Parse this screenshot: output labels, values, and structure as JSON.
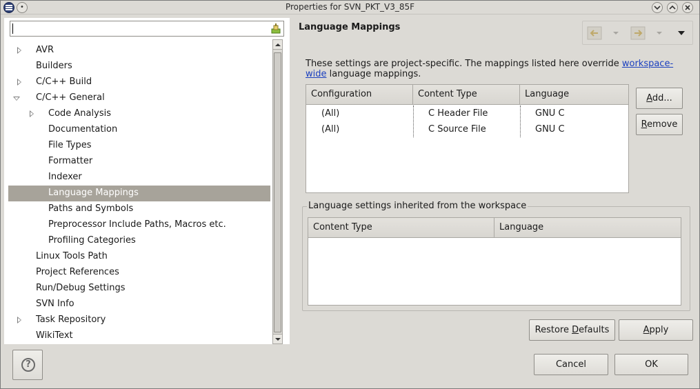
{
  "window": {
    "title": "Properties for SVN_PKT_V3_85F"
  },
  "filter": {
    "value": "",
    "placeholder": ""
  },
  "tree": {
    "items": [
      {
        "label": "AVR",
        "level": 1,
        "twisty": "collapsed",
        "selected": false
      },
      {
        "label": "Builders",
        "level": 1,
        "twisty": "none",
        "selected": false
      },
      {
        "label": "C/C++ Build",
        "level": 1,
        "twisty": "collapsed",
        "selected": false
      },
      {
        "label": "C/C++ General",
        "level": 1,
        "twisty": "expanded",
        "selected": false
      },
      {
        "label": "Code Analysis",
        "level": 2,
        "twisty": "collapsed",
        "selected": false
      },
      {
        "label": "Documentation",
        "level": 2,
        "twisty": "none",
        "selected": false
      },
      {
        "label": "File Types",
        "level": 2,
        "twisty": "none",
        "selected": false
      },
      {
        "label": "Formatter",
        "level": 2,
        "twisty": "none",
        "selected": false
      },
      {
        "label": "Indexer",
        "level": 2,
        "twisty": "none",
        "selected": false
      },
      {
        "label": "Language Mappings",
        "level": 2,
        "twisty": "none",
        "selected": true
      },
      {
        "label": "Paths and Symbols",
        "level": 2,
        "twisty": "none",
        "selected": false
      },
      {
        "label": "Preprocessor Include Paths, Macros etc.",
        "level": 2,
        "twisty": "none",
        "selected": false
      },
      {
        "label": "Profiling Categories",
        "level": 2,
        "twisty": "none",
        "selected": false
      },
      {
        "label": "Linux Tools Path",
        "level": 1,
        "twisty": "none",
        "selected": false
      },
      {
        "label": "Project References",
        "level": 1,
        "twisty": "none",
        "selected": false
      },
      {
        "label": "Run/Debug Settings",
        "level": 1,
        "twisty": "none",
        "selected": false
      },
      {
        "label": "SVN Info",
        "level": 1,
        "twisty": "none",
        "selected": false
      },
      {
        "label": "Task Repository",
        "level": 1,
        "twisty": "collapsed",
        "selected": false
      },
      {
        "label": "WikiText",
        "level": 1,
        "twisty": "none",
        "selected": false
      }
    ]
  },
  "page": {
    "title": "Language Mappings",
    "description_prefix": "These settings are project-specific.  The mappings listed here override ",
    "link_text_1": "workspace-",
    "link_text_2": "wide",
    "description_suffix": " language mappings."
  },
  "mappings_table": {
    "headers": [
      "Configuration",
      "Content Type",
      "Language"
    ],
    "rows": [
      [
        "(All)",
        "C Header File",
        "GNU C"
      ],
      [
        "(All)",
        "C Source File",
        "GNU C"
      ]
    ]
  },
  "buttons": {
    "add": {
      "pre": "",
      "mnemonic": "A",
      "post": "dd..."
    },
    "remove": {
      "pre": "",
      "mnemonic": "R",
      "post": "emove"
    },
    "restore_defaults": {
      "pre": "Restore ",
      "mnemonic": "D",
      "post": "efaults"
    },
    "apply": {
      "pre": "",
      "mnemonic": "A",
      "post": "pply"
    },
    "cancel": "Cancel",
    "ok": "OK",
    "help": "?"
  },
  "inherited": {
    "group_title": "Language settings inherited from the workspace",
    "headers": [
      "Content Type",
      "Language"
    ],
    "rows": []
  },
  "icons": {
    "back": "back-arrow-icon",
    "forward": "forward-arrow-icon",
    "clear": "clear-filter-icon",
    "view_menu": "view-menu-icon"
  },
  "colors": {
    "selection": "#a7a39a",
    "background": "#dcdad5",
    "link": "#1a3fbf"
  }
}
